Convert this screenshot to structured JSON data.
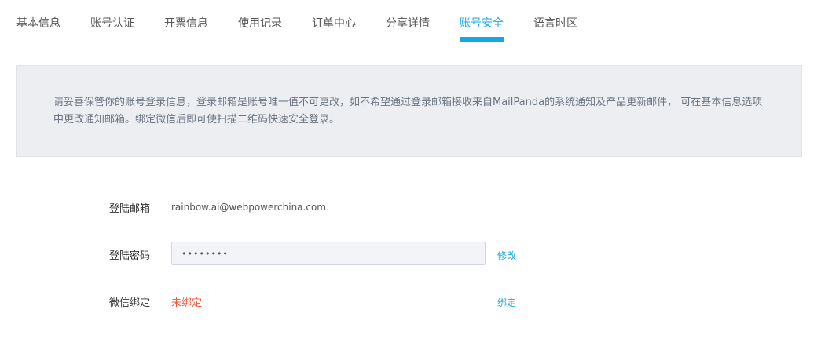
{
  "tabs": [
    {
      "label": "基本信息"
    },
    {
      "label": "账号认证"
    },
    {
      "label": "开票信息"
    },
    {
      "label": "使用记录"
    },
    {
      "label": "订单中心"
    },
    {
      "label": "分享详情"
    },
    {
      "label": "账号安全",
      "active": true
    },
    {
      "label": "语言时区"
    }
  ],
  "notice": {
    "text": "请妥善保管你的账号登录信息，登录邮箱是账号唯一值不可更改，如不希望通过登录邮箱接收来自MailPanda的系统通知及产品更新邮件， 可在基本信息选项中更改通知邮箱。绑定微信后即可使扫描二维码快速安全登录。"
  },
  "email": {
    "label": "登陆邮箱",
    "value": "rainbow.ai@webpowerchina.com"
  },
  "password": {
    "label": "登陆密码",
    "value": "••••••••",
    "action": "修改"
  },
  "wechat": {
    "label": "微信绑定",
    "status": "未绑定",
    "action": "绑定"
  },
  "colors": {
    "accent": "#13a9e6",
    "warning": "#f05a3a",
    "notice_bg": "#eceef1"
  }
}
